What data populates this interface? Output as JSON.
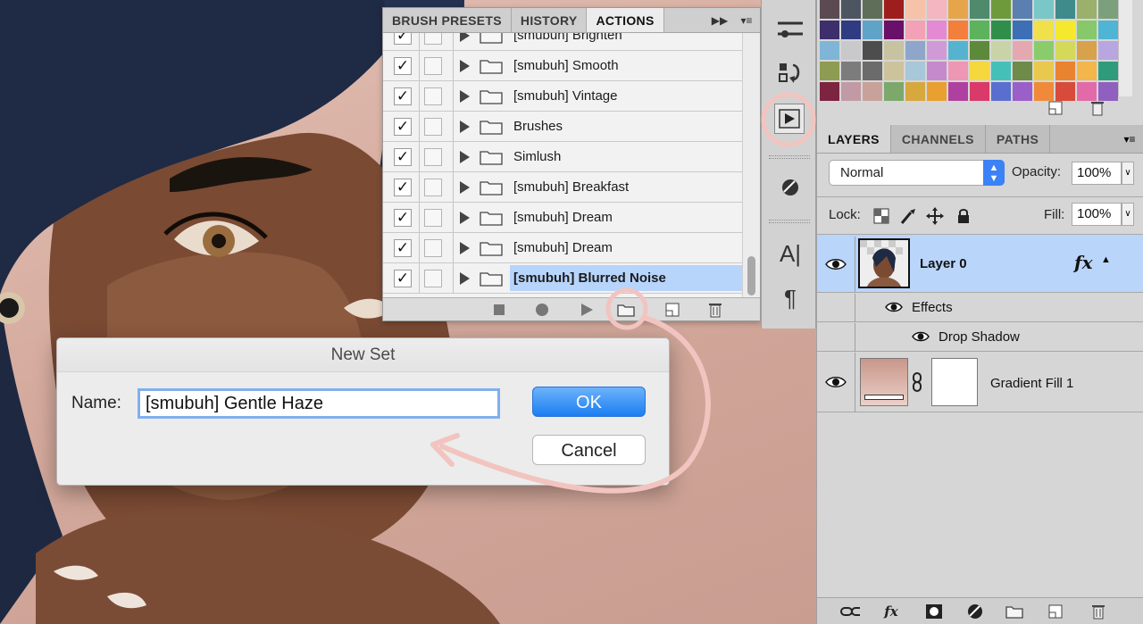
{
  "actions_panel": {
    "tabs": [
      "BRUSH PRESETS",
      "HISTORY",
      "ACTIONS"
    ],
    "active_tab": "ACTIONS",
    "items": [
      {
        "label": "[smubuh] Brighten"
      },
      {
        "label": "[smubuh] Smooth"
      },
      {
        "label": "[smubuh] Vintage"
      },
      {
        "label": "Brushes"
      },
      {
        "label": "Simlush"
      },
      {
        "label": "[smubuh] Breakfast"
      },
      {
        "label": "[smubuh] Dream"
      },
      {
        "label": "[smubuh] Dream"
      },
      {
        "label": "[smubuh] Blurred Noise"
      }
    ],
    "selected_item": "[smubuh] Blurred Noise",
    "checkmark": "✓"
  },
  "layers_panel": {
    "tabs": [
      "LAYERS",
      "CHANNELS",
      "PATHS"
    ],
    "active_tab": "LAYERS",
    "blend_mode": "Normal",
    "opacity_label": "Opacity:",
    "opacity_value": "100%",
    "lock_label": "Lock:",
    "fill_label": "Fill:",
    "fill_value": "100%",
    "layers": [
      {
        "name": "Layer 0",
        "fx": "fx",
        "effects_label": "Effects",
        "effect": "Drop Shadow"
      },
      {
        "name": "Gradient Fill 1"
      }
    ],
    "footer_fx": "fx"
  },
  "dialog": {
    "title": "New Set",
    "name_label": "Name:",
    "name_value": "[smubuh] Gentle Haze",
    "ok_label": "OK",
    "cancel_label": "Cancel"
  },
  "tool_strip": {
    "char_label": "A|",
    "para_label": "¶"
  },
  "colors": {
    "selection": "#b7d4fb",
    "annotation": "#f2c4c0",
    "ok_button": "#1b7ef1",
    "swatches": [
      "#5b4a52",
      "#4d5561",
      "#5f6e58",
      "#9e1e1e",
      "#f6c2a9",
      "#f4b6c0",
      "#e6a54b",
      "#4e8a6b",
      "#6e9a3c",
      "#5a7fb0",
      "#7ac7c8",
      "#3f8a8a",
      "#9bb06b",
      "#7ca07c",
      "#3c2f6b",
      "#2f3c82",
      "#5fa3c8",
      "#6a0f6a",
      "#f2a1b6",
      "#e38ad3",
      "#f37f3a",
      "#5cb35c",
      "#2f8f4a",
      "#3d6fb6",
      "#f0e04a",
      "#f5e92e",
      "#86c86a",
      "#50b4d4",
      "#7fb5d6",
      "#c9c9cc",
      "#4d4d4d",
      "#c7c3a1",
      "#8ea6c9",
      "#d09ad7",
      "#55b3d0",
      "#5c8a3a",
      "#c8d4a8",
      "#e6a8b0",
      "#8acc6a",
      "#d4d95a",
      "#d7a24a",
      "#b8a6e0",
      "#8e9b52",
      "#7c7c7c",
      "#6b6b6b",
      "#ccc39d",
      "#a8c7d9",
      "#c58acc",
      "#ee97b5",
      "#f4d83e",
      "#45c0b8",
      "#6f8b4a",
      "#e9c94d",
      "#ea8330",
      "#f4b54b",
      "#2e9c7a",
      "#7c2440",
      "#c19aa5",
      "#c9a19b",
      "#7ca96b",
      "#d6a83d",
      "#e9a030",
      "#b040a0",
      "#d93a6a",
      "#5a6ecf",
      "#9a5fc8",
      "#f08a3a",
      "#d84a3a",
      "#e36aa8",
      "#8f60c0"
    ]
  }
}
